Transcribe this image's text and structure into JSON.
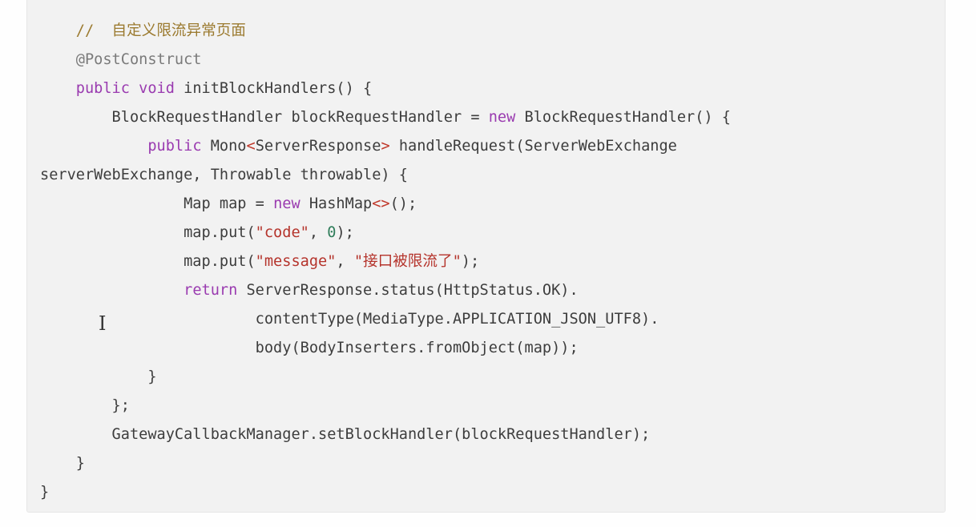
{
  "colors": {
    "background": "#fefefe",
    "code_background": "#f2f2f2",
    "plain": "#3d3d3d",
    "comment": "#9b7a2f",
    "keyword": "#9a3bb0",
    "string": "#b5342c",
    "number": "#2f7d5a",
    "annotation": "#7a7a7a"
  },
  "cursor": {
    "icon": "text-cursor-icon",
    "glyph": "I"
  },
  "code": {
    "language": "java",
    "lines": [
      [
        {
          "t": "    ",
          "k": "plain"
        },
        {
          "t": "//  自定义限流异常页面",
          "k": "comment"
        }
      ],
      [
        {
          "t": "    ",
          "k": "plain"
        },
        {
          "t": "@PostConstruct",
          "k": "annotation"
        }
      ],
      [
        {
          "t": "    ",
          "k": "plain"
        },
        {
          "t": "public",
          "k": "keyword"
        },
        {
          "t": " ",
          "k": "plain"
        },
        {
          "t": "void",
          "k": "keyword"
        },
        {
          "t": " initBlockHandlers() {",
          "k": "plain"
        }
      ],
      [
        {
          "t": "        BlockRequestHandler blockRequestHandler = ",
          "k": "plain"
        },
        {
          "t": "new",
          "k": "keyword"
        },
        {
          "t": " BlockRequestHandler() {",
          "k": "plain"
        }
      ],
      [
        {
          "t": "            ",
          "k": "plain"
        },
        {
          "t": "public",
          "k": "keyword"
        },
        {
          "t": " Mono",
          "k": "plain"
        },
        {
          "t": "<",
          "k": "generic"
        },
        {
          "t": "ServerResponse",
          "k": "plain"
        },
        {
          "t": ">",
          "k": "generic"
        },
        {
          "t": " handleRequest(ServerWebExchange",
          "k": "plain"
        }
      ],
      [
        {
          "t": "serverWebExchange, Throwable throwable) {",
          "k": "plain"
        }
      ],
      [
        {
          "t": "                Map map = ",
          "k": "plain"
        },
        {
          "t": "new",
          "k": "keyword"
        },
        {
          "t": " HashMap",
          "k": "plain"
        },
        {
          "t": "<>",
          "k": "generic"
        },
        {
          "t": "();",
          "k": "plain"
        }
      ],
      [
        {
          "t": "                map.put(",
          "k": "plain"
        },
        {
          "t": "\"code\"",
          "k": "string"
        },
        {
          "t": ", ",
          "k": "plain"
        },
        {
          "t": "0",
          "k": "number"
        },
        {
          "t": ");",
          "k": "plain"
        }
      ],
      [
        {
          "t": "                map.put(",
          "k": "plain"
        },
        {
          "t": "\"message\"",
          "k": "string"
        },
        {
          "t": ", ",
          "k": "plain"
        },
        {
          "t": "\"接口被限流了\"",
          "k": "string"
        },
        {
          "t": ");",
          "k": "plain"
        }
      ],
      [
        {
          "t": "                ",
          "k": "plain"
        },
        {
          "t": "return",
          "k": "keyword"
        },
        {
          "t": " ServerResponse.status(HttpStatus.OK).",
          "k": "plain"
        }
      ],
      [
        {
          "t": "                        contentType(MediaType.APPLICATION_JSON_UTF8).",
          "k": "plain"
        }
      ],
      [
        {
          "t": "                        body(BodyInserters.fromObject(map));",
          "k": "plain"
        }
      ],
      [
        {
          "t": "            }",
          "k": "plain"
        }
      ],
      [
        {
          "t": "        };",
          "k": "plain"
        }
      ],
      [
        {
          "t": "        GatewayCallbackManager.setBlockHandler(blockRequestHandler);",
          "k": "plain"
        }
      ],
      [
        {
          "t": "    }",
          "k": "plain"
        }
      ],
      [
        {
          "t": "}",
          "k": "plain"
        }
      ]
    ]
  }
}
